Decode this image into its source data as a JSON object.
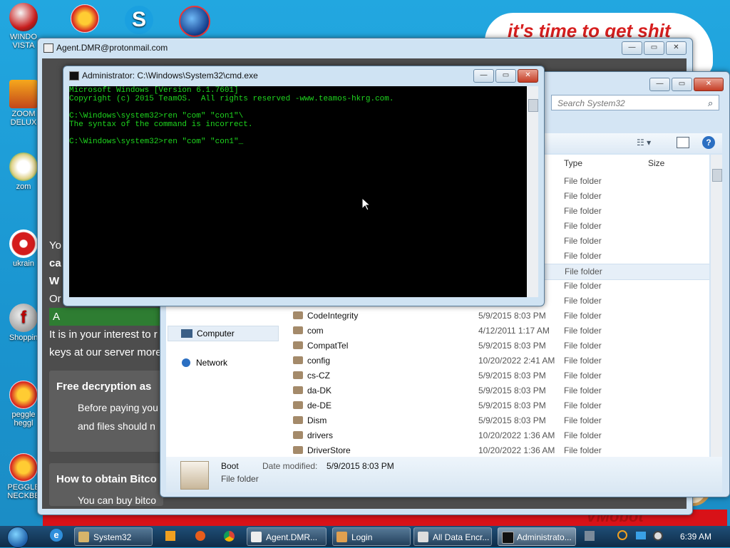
{
  "desktop": {
    "icons": [
      {
        "label": "WINDO VISTA"
      },
      {
        "label": "ZOOM DELUX"
      },
      {
        "label": "zom"
      },
      {
        "label": "ukrain"
      },
      {
        "label": "Shoppin"
      },
      {
        "label": "peggle heggl"
      },
      {
        "label": "PEGGLE NECKBE"
      }
    ],
    "wallpaper_top_text": "it's time to get shit",
    "wallpaper_bottom_text": "VMobot"
  },
  "agent_window": {
    "title": "Agent.DMR@protonmail.com",
    "lines": [
      "Yo",
      "ca",
      "W",
      "Or",
      "A"
    ],
    "line_interest": "It is in your interest to r",
    "line_keys": "keys at our server more",
    "free_decryption_title": "Free decryption as",
    "free_decryption_text1": "Before paying you",
    "free_decryption_text2": "and files should n",
    "obtain_title": "How to obtain Bitco",
    "obtain_text": "You can buy bitco",
    "obtain_link": "https://localbitcoins.com/buy_bitcoins"
  },
  "explorer": {
    "search_placeholder": "Search System32",
    "columns": {
      "type": "Type",
      "size": "Size"
    },
    "nav": {
      "computer": "Computer",
      "network": "Network"
    },
    "rows": [
      {
        "name": "",
        "date": "",
        "type": "File folder"
      },
      {
        "name": "",
        "date": "",
        "type": "File folder"
      },
      {
        "name": "",
        "date": "",
        "type": "File folder"
      },
      {
        "name": "",
        "date": "",
        "type": "File folder"
      },
      {
        "name": "",
        "date": "",
        "type": "File folder"
      },
      {
        "name": "",
        "date": "",
        "type": "File folder"
      },
      {
        "name": "",
        "date": "",
        "type": "File folder"
      },
      {
        "name": "",
        "date": "",
        "type": "File folder"
      },
      {
        "name": "",
        "date": "",
        "type": "File folder"
      },
      {
        "name": "CodeIntegrity",
        "date": "5/9/2015 8:03 PM",
        "type": "File folder"
      },
      {
        "name": "com",
        "date": "4/12/2011 1:17 AM",
        "type": "File folder"
      },
      {
        "name": "CompatTel",
        "date": "5/9/2015 8:03 PM",
        "type": "File folder"
      },
      {
        "name": "config",
        "date": "10/20/2022 2:41 AM",
        "type": "File folder"
      },
      {
        "name": "cs-CZ",
        "date": "5/9/2015 8:03 PM",
        "type": "File folder"
      },
      {
        "name": "da-DK",
        "date": "5/9/2015 8:03 PM",
        "type": "File folder"
      },
      {
        "name": "de-DE",
        "date": "5/9/2015 8:03 PM",
        "type": "File folder"
      },
      {
        "name": "Dism",
        "date": "5/9/2015 8:03 PM",
        "type": "File folder"
      },
      {
        "name": "drivers",
        "date": "10/20/2022 1:36 AM",
        "type": "File folder"
      },
      {
        "name": "DriverStore",
        "date": "10/20/2022 1:36 AM",
        "type": "File folder"
      }
    ],
    "details": {
      "name": "Boot",
      "kind": "File folder",
      "date_label": "Date modified:",
      "date_value": "5/9/2015 8:03 PM"
    }
  },
  "cmd": {
    "title": "Administrator: C:\\Windows\\System32\\cmd.exe",
    "lines": [
      "Microsoft Windows [Version 6.1.7601]",
      "Copyright (c) 2015 TeamOS.  All rights reserved -www.teamos-hkrg.com.",
      "",
      "C:\\Windows\\system32>ren \"com\" \"con1\"\\",
      "The syntax of the command is incorrect.",
      "",
      "C:\\Windows\\system32>ren \"com\" \"con1\"_"
    ]
  },
  "taskbar": {
    "buttons": [
      {
        "label": "System32"
      },
      {
        "label": "Agent.DMR..."
      },
      {
        "label": "Login"
      },
      {
        "label": "All Data Encr..."
      },
      {
        "label": "Administrato..."
      }
    ],
    "clock": "6:39 AM"
  }
}
